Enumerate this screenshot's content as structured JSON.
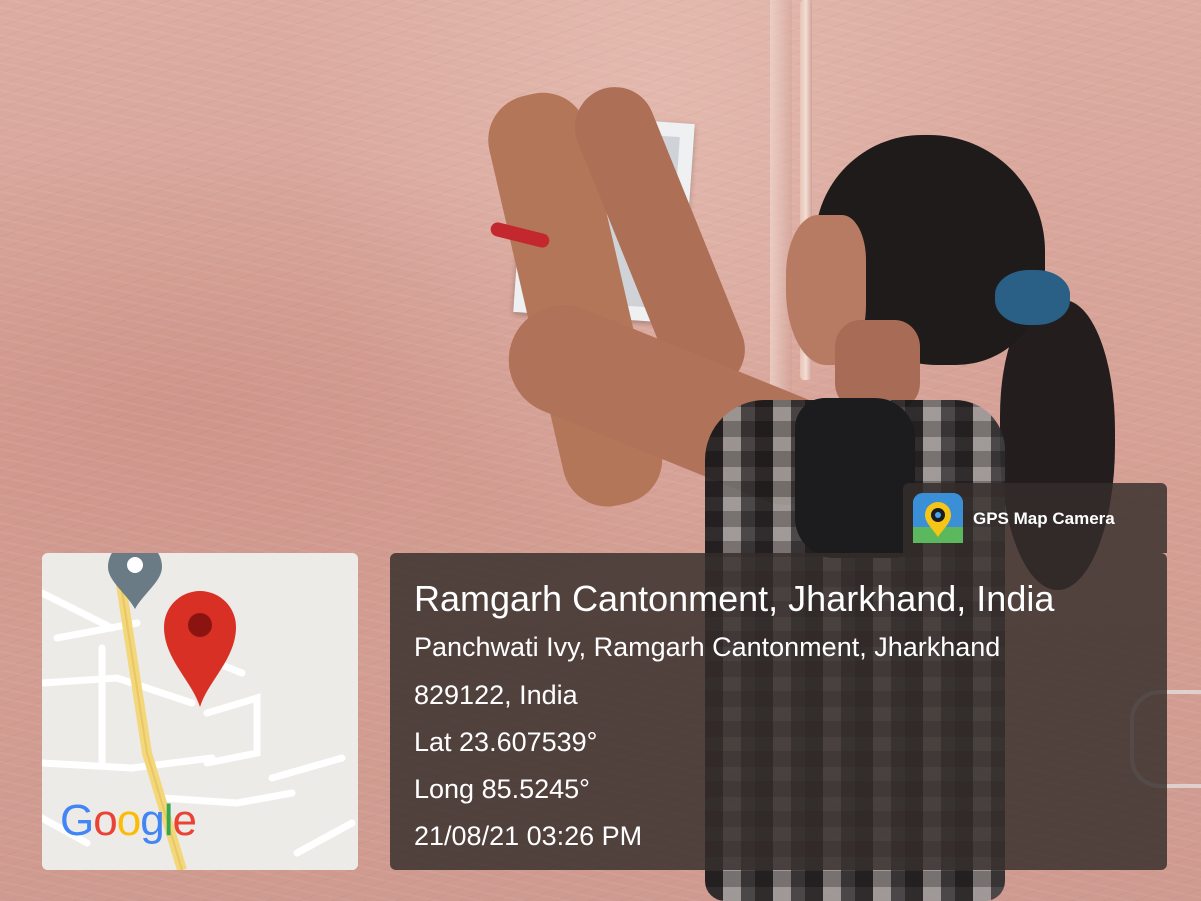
{
  "badge": {
    "app_name": "GPS Map Camera",
    "icon": "gps-map-camera-icon"
  },
  "location": {
    "title": "Ramgarh Cantonment, Jharkhand, India",
    "address_line1": "Panchwati Ivy, Ramgarh Cantonment, Jharkhand",
    "address_line2": "829122, India",
    "latitude": "Lat 23.607539°",
    "longitude": "Long 85.5245°",
    "timestamp": "21/08/21 03:26 PM"
  },
  "map": {
    "logo": {
      "letters": [
        "G",
        "o",
        "o",
        "g",
        "l",
        "e"
      ],
      "colors": [
        "#4285F4",
        "#EA4335",
        "#FBBC05",
        "#4285F4",
        "#34A853",
        "#EA4335"
      ]
    },
    "pin_color": "#d93025",
    "secondary_pin_color": "#6b7b86"
  },
  "colors": {
    "panel_bg": "#342d2b",
    "panel_text": "#ffffff"
  }
}
